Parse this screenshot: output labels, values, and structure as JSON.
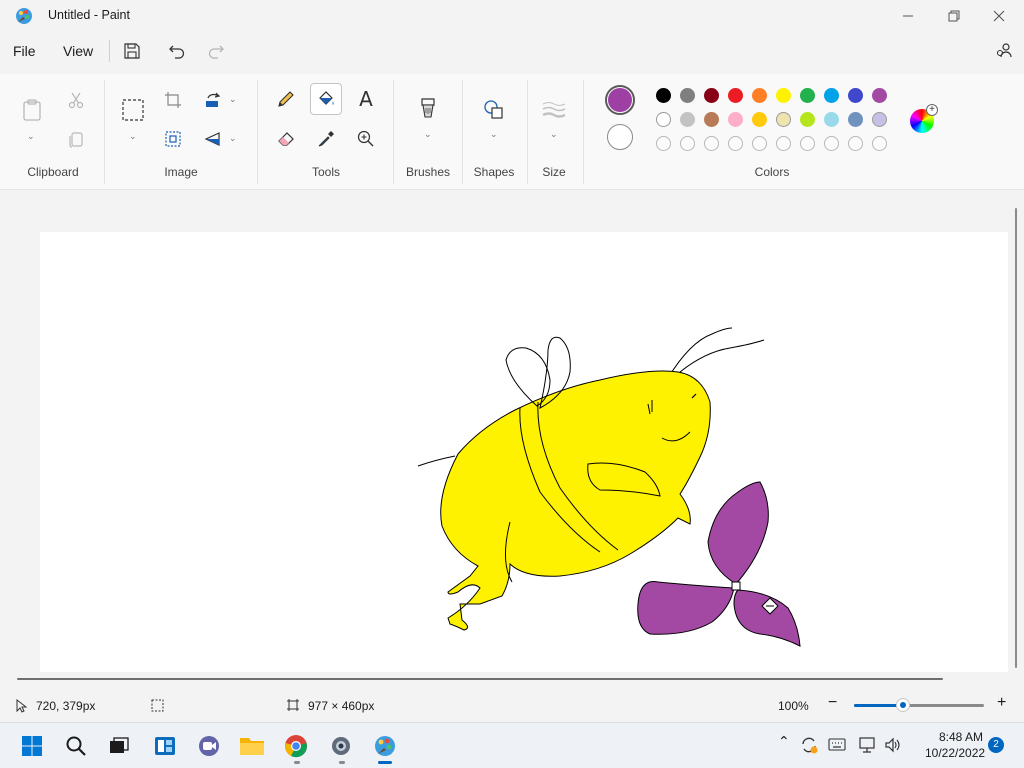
{
  "window": {
    "title": "Untitled - Paint"
  },
  "menu": {
    "file": "File",
    "view": "View"
  },
  "ribbon": {
    "groups": {
      "clipboard": "Clipboard",
      "image": "Image",
      "tools": "Tools",
      "brushes": "Brushes",
      "shapes": "Shapes",
      "size": "Size",
      "colors": "Colors"
    },
    "text_tool_glyph": "A"
  },
  "colors": {
    "color1": "#9e3fa4",
    "color2": "#ffffff",
    "palette_row1": [
      "#000000",
      "#7f7f7f",
      "#880015",
      "#ed1c24",
      "#ff7f27",
      "#fff200",
      "#22b14c",
      "#00a2e8",
      "#3f48cc",
      "#a349a4"
    ],
    "palette_row2": [
      "#ffffff",
      "#c3c3c3",
      "#b97a57",
      "#ffaec9",
      "#ffc90e",
      "#efe4b0",
      "#b5e61d",
      "#99d9ea",
      "#7092be",
      "#c8bfe7"
    ],
    "palette_row3_count_empty": 10
  },
  "drawing": {
    "bee_fill": "#fff200",
    "flower_fill": "#a349a4",
    "outline": "#000000"
  },
  "status": {
    "cursor_position": "720, 379px",
    "canvas_size": "977 × 460px",
    "zoom": "100%",
    "zoom_level": 0.38
  },
  "taskbar": {
    "time": "8:48 AM",
    "date": "10/22/2022",
    "notifications": "2"
  }
}
